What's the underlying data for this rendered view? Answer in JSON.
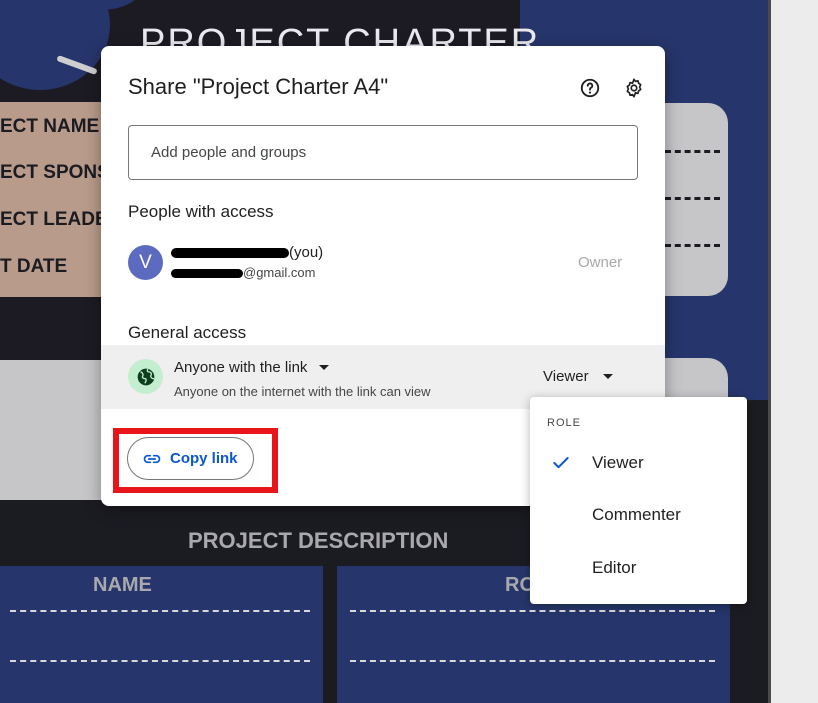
{
  "background": {
    "title": "PROJECT CHARTER",
    "labels": [
      "ECT NAME",
      "ECT SPONS",
      "ECT LEADE",
      "T DATE"
    ],
    "description_heading": "PROJECT DESCRIPTION",
    "column_headers": [
      "NAME",
      "RO"
    ]
  },
  "dialog": {
    "title": "Share \"Project Charter A4\"",
    "help_icon": "help-circle-icon",
    "settings_icon": "gear-icon",
    "add_people_placeholder": "Add people and groups",
    "people_section_title": "People with access",
    "user": {
      "avatar_letter": "V",
      "name_suffix": "(you)",
      "email_suffix": "@gmail.com",
      "role": "Owner"
    },
    "general_access_title": "General access",
    "general_access": {
      "type": "Anyone with the link",
      "description": "Anyone on the internet with the link can view",
      "role": "Viewer"
    },
    "copy_link_label": "Copy link",
    "copy_link_icon": "link-icon"
  },
  "role_menu": {
    "header": "ROLE",
    "items": [
      {
        "label": "Viewer",
        "selected": true
      },
      {
        "label": "Commenter",
        "selected": false
      },
      {
        "label": "Editor",
        "selected": false
      }
    ]
  },
  "colors": {
    "accent_blue": "#0b57d0",
    "highlight_red": "#e8151b",
    "avatar": "#5c6bc0",
    "globe_bg": "#c4eed0"
  }
}
